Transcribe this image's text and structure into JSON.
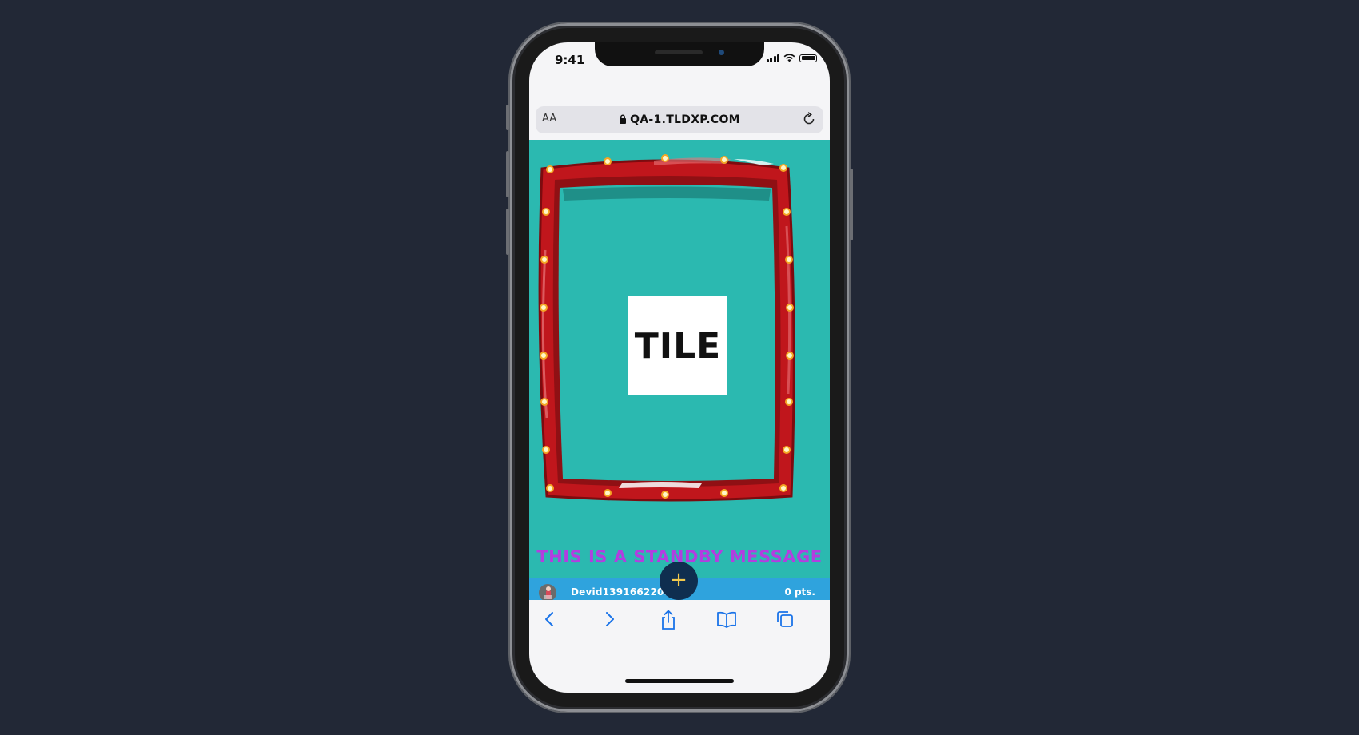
{
  "status_bar": {
    "time": "9:41"
  },
  "browser": {
    "text_size_label": "AA",
    "url": "QA-1.TLDXP.COM",
    "toolbar_icons": [
      "back-icon",
      "forward-icon",
      "share-icon",
      "bookmarks-icon",
      "tabs-icon"
    ]
  },
  "stage": {
    "tile_label": "TILE",
    "standby_message": "This is a standby message"
  },
  "user_bar": {
    "username": "Devid13916622053",
    "points": "0 pts."
  },
  "fab": {
    "label": "+"
  },
  "colors": {
    "background": "#222836",
    "content_bg": "#2bb9b0",
    "frame_red": "#c0161c",
    "standby_text": "#b23ee0",
    "user_bar": "#2fa3dd",
    "fab_bg": "#0f2e4f",
    "fab_plus": "#f2c94c",
    "link_blue": "#1a73e8"
  }
}
